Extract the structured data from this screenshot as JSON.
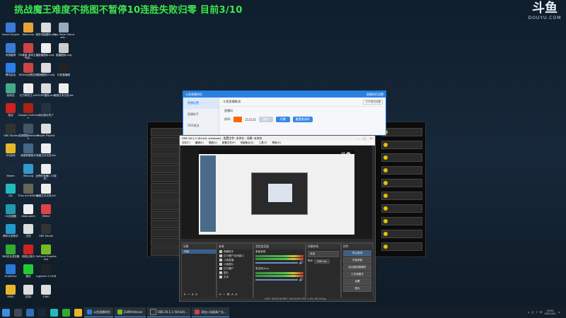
{
  "overlay": {
    "banner": "挑战魔王难度不挑图不暂停10连胜失败归零  目前3/10",
    "logo_cn": "斗鱼",
    "logo_en": "DOUYU.COM"
  },
  "desktop_icons": [
    {
      "label": "Visual Engine",
      "col": 0,
      "row": 0,
      "color": "#3a7bd5"
    },
    {
      "label": "Welcome",
      "col": 1,
      "row": 0,
      "color": "#e8a23a"
    },
    {
      "label": "我的电脑图标.png",
      "col": 2,
      "row": 0,
      "color": "#ddd"
    },
    {
      "label": "Tiny Team Standard...",
      "col": 3,
      "row": 0,
      "color": "#9ab"
    },
    {
      "label": "系统截屏",
      "col": 0,
      "row": 1,
      "color": "#3a7bd5"
    },
    {
      "label": "TM桌面-游戏主播专用...",
      "col": 1,
      "row": 1,
      "color": "#c44"
    },
    {
      "label": "直播图标.png",
      "col": 2,
      "row": 1,
      "color": "#eee"
    },
    {
      "label": "直播图标.png",
      "col": 3,
      "row": 1,
      "color": "#ccc"
    },
    {
      "label": "腾讯会议",
      "col": 0,
      "row": 2,
      "color": "#2b7de9"
    },
    {
      "label": "ToDesk远程控制",
      "col": 1,
      "row": 2,
      "color": "#c44"
    },
    {
      "label": "直播图标2.png",
      "col": 2,
      "row": 2,
      "color": "#ddd"
    },
    {
      "label": "抖音直播图",
      "col": 3,
      "row": 2,
      "color": "#222"
    },
    {
      "label": "回收站",
      "col": 0,
      "row": 3,
      "color": "#4a8"
    },
    {
      "label": "亿万精灵王.txt",
      "col": 1,
      "row": 3,
      "color": "#eee"
    },
    {
      "label": "OCDR图标.png",
      "col": 2,
      "row": 3,
      "color": "#ddd"
    },
    {
      "label": "新建文本文档.txt",
      "col": 3,
      "row": 3,
      "color": "#eee"
    },
    {
      "label": "激活",
      "col": 0,
      "row": 4,
      "color": "#c22"
    },
    {
      "label": "Dragon Summon",
      "col": 1,
      "row": 4,
      "color": "#a21"
    },
    {
      "label": "读记魔女的了",
      "col": 2,
      "row": 4,
      "color": "#234"
    },
    {
      "label": "OBS Studio",
      "col": 0,
      "row": 5,
      "color": "#333"
    },
    {
      "label": "英雄联盟WeGame",
      "col": 1,
      "row": 5,
      "color": "#456"
    },
    {
      "label": "Bright Playlist",
      "col": 2,
      "row": 5,
      "color": "#ddd"
    },
    {
      "label": "QQ游戏",
      "col": 0,
      "row": 6,
      "color": "#e5b82a"
    },
    {
      "label": "英雄联盟助手",
      "col": 1,
      "row": 6,
      "color": "#468"
    },
    {
      "label": "新建文本文档.txt",
      "col": 2,
      "row": 6,
      "color": "#eee"
    },
    {
      "label": "Steam",
      "col": 0,
      "row": 7,
      "color": "#1b2838"
    },
    {
      "label": "WeLong",
      "col": 1,
      "row": 7,
      "color": "#39c"
    },
    {
      "label": "龙神的宝藏2.10版本...",
      "col": 2,
      "row": 7,
      "color": "#eee"
    },
    {
      "label": "QQ",
      "col": 0,
      "row": 8,
      "color": "#2bb"
    },
    {
      "label": "They are Billions",
      "col": 1,
      "row": 8,
      "color": "#665"
    },
    {
      "label": "新建文本文档.txt",
      "col": 2,
      "row": 8,
      "color": "#eee"
    },
    {
      "label": "UU加速器",
      "col": 0,
      "row": 9,
      "color": "#29a"
    },
    {
      "label": "dataupoint",
      "col": 1,
      "row": 9,
      "color": "#eee"
    },
    {
      "label": "XMind",
      "col": 2,
      "row": 9,
      "color": "#d44"
    },
    {
      "label": "腾讯手游助手",
      "col": 0,
      "row": 10,
      "color": "#29c"
    },
    {
      "label": "文档",
      "col": 1,
      "row": 10,
      "color": "#ddd"
    },
    {
      "label": "OBS Studio",
      "col": 2,
      "row": 10,
      "color": "#333"
    },
    {
      "label": "360安全浏览器",
      "col": 0,
      "row": 11,
      "color": "#3a3"
    },
    {
      "label": "网易云音乐",
      "col": 1,
      "row": 11,
      "color": "#c22"
    },
    {
      "label": "GeForce Experience",
      "col": 2,
      "row": 11,
      "color": "#7b2"
    },
    {
      "label": "OneDrive",
      "col": 0,
      "row": 12,
      "color": "#2878d8"
    },
    {
      "label": "微信",
      "col": 1,
      "row": 12,
      "color": "#2c3"
    },
    {
      "label": "Logitech G HUB",
      "col": 2,
      "row": 12,
      "color": "#222"
    },
    {
      "label": "KING",
      "col": 0,
      "row": 13,
      "color": "#e5b82a"
    },
    {
      "label": "文档1",
      "col": 1,
      "row": 13,
      "color": "#ddd"
    },
    {
      "label": "1080",
      "col": 2,
      "row": 13,
      "color": "#ddd"
    }
  ],
  "blue_window": {
    "title": "斗鱼直播伴侣",
    "title_right": "直播伴侣设置",
    "side_items": [
      "直播设置",
      "直播助手",
      "OBS推流"
    ],
    "heading": "斗鱼直播推流",
    "subheading": "直播码",
    "room_label": "房间:",
    "room_number": "213133",
    "btn_copy": "复制",
    "btn_start": "开播",
    "btn_reset": "重置推流码",
    "btn_settings": "打开推流设置"
  },
  "obs": {
    "title": "OBS 26.1.1 (64-bit, windows) - 配置文件: 未命名 - 场景: 未命名",
    "menu": [
      "文件(F)",
      "编辑(E)",
      "视图(V)",
      "配置文件(P)",
      "场景集合(S)",
      "工具(T)",
      "帮助(H)"
    ],
    "dock_scenes": "场景",
    "scene_item": "场景",
    "dock_sources": "来源",
    "sources": [
      "弹幕助手",
      "亿万僵尸游戏窗口",
      "斗鱼直播",
      "斗鱼图片",
      "亿万僵尸",
      "图片",
      "文本"
    ],
    "dock_mixer": "音频混音器",
    "mixer_channels": [
      "桌面音频",
      "麦克风/Aux"
    ],
    "dock_transitions": "场景转场",
    "transition_name": "淡出",
    "duration_label": "时长",
    "duration": "300 ms",
    "dock_controls": "控件",
    "controls": [
      "停止推流",
      "开始录制",
      "启动虚拟摄像机",
      "工作室模式",
      "设置",
      "退出"
    ],
    "status": "LIVE: 00:00:00   REC: 00:00:00   CPU: 2.4%, 60.00 fps"
  },
  "taskbar": {
    "tasks": [
      {
        "label": "斗鱼直播伴侣"
      },
      {
        "label": "ZeNProfessor"
      },
      {
        "label": "OBS 26.1.1 (64-bit)..."
      },
      {
        "label": "添加入场道具广告..."
      }
    ],
    "time": "19:52",
    "date": "2021/4/1",
    "lang": "中"
  }
}
